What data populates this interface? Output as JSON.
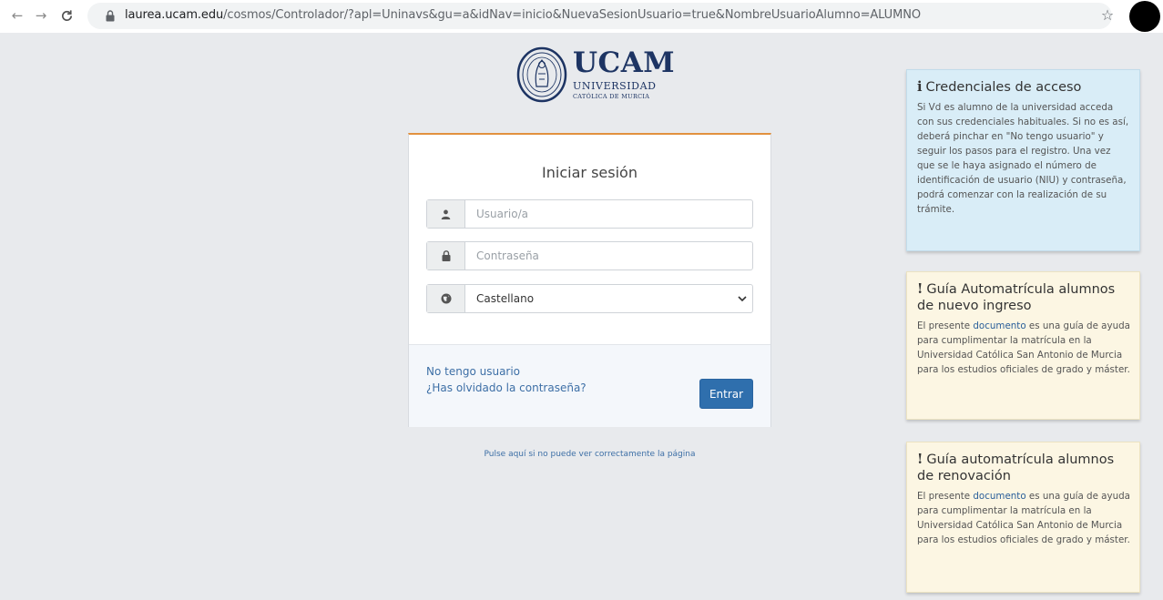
{
  "browser": {
    "url_host": "laurea.ucam.edu",
    "url_path": "/cosmos/Controlador/?apl=Uninavs&gu=a&idNav=inicio&NuevaSesionUsuario=true&NombreUsuarioAlumno=ALUMNO",
    "icons": {
      "back": "arrow-left-icon",
      "forward": "arrow-right-icon",
      "reload": "reload-icon",
      "lock": "lock-icon",
      "bookmark": "star-icon"
    }
  },
  "logo": {
    "name": "UCAM",
    "line1": "UNIVERSIDAD",
    "line2": "CATÓLICA DE MURCIA",
    "color": "#1d3463"
  },
  "login": {
    "title": "Iniciar sesión",
    "user_placeholder": "Usuario/a",
    "password_placeholder": "Contraseña",
    "language_selected": "Castellano",
    "no_user_link": "No tengo usuario",
    "forgot_link": "¿Has olvidado la contraseña?",
    "enter_button": "Entrar",
    "accent_color": "#e2913f",
    "button_color": "#2f6fad"
  },
  "footer_link": "Pulse aquí si no puede ver correctamente la página",
  "panels": {
    "credentials": {
      "icon": "i",
      "title": "Credenciales de acceso",
      "body": "Si Vd es alumno de la universidad acceda con sus credenciales habituales. Si no es así, deberá pinchar en \"No tengo usuario\" y seguir los pasos para el registro. Una vez que se le haya asignado el número de identificación de usuario (NIU) y contraseña, podrá comenzar con la realización de su trámite."
    },
    "guide_new": {
      "icon": "!",
      "title": "Guía Automatrícula alumnos de nuevo ingreso",
      "body_before": "El presente ",
      "link": "documento",
      "body_after": " es una guía de ayuda para cumplimentar la matrícula en la Universidad Católica San Antonio de Murcia para los estudios oficiales de grado y máster."
    },
    "guide_renewal": {
      "icon": "!",
      "title": "Guía automatrícula alumnos de renovación",
      "body_before": "El presente ",
      "link": "documento",
      "body_after": " es una guía de ayuda para cumplimentar la matrícula en la Universidad Católica San Antonio de Murcia para los estudios oficiales de grado y máster."
    }
  }
}
